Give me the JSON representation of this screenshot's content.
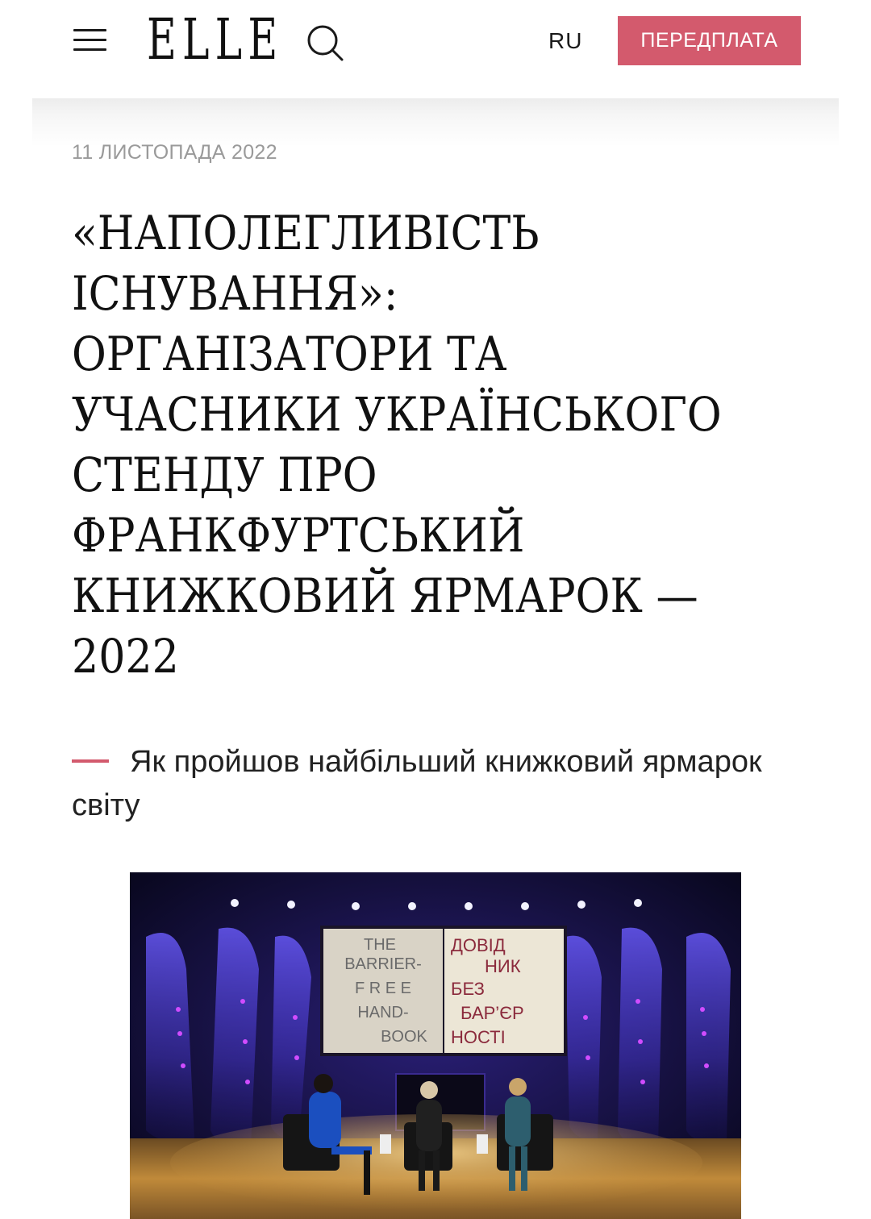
{
  "header": {
    "logo": "ELLE",
    "lang_label": "RU",
    "subscribe_label": "ПЕРЕДПЛАТА",
    "accent_color": "#d35a6d"
  },
  "article": {
    "date": "11 ЛИСТОПАДА 2022",
    "title_lines": [
      "«НАПОЛЕГЛИВІСТЬ",
      "ІСНУВАННЯ»:",
      "ОРГАНІЗАТОРИ ТА",
      "УЧАСНИКИ УКРАЇНСЬКОГО",
      "СТЕНДУ ПРО",
      "ФРАНКФУРТСЬКИЙ",
      "КНИЖКОВИЙ ЯРМАРОК —",
      "2022"
    ],
    "lead": "Як пройшов найбільший книжковий ярмарок світу"
  },
  "photo": {
    "screen_left_lines": [
      "THE",
      "BARRIER-",
      "F R E E",
      "HAND-",
      "BOOK"
    ],
    "screen_right_lines": [
      "ДОВІД",
      "НИК",
      "БЕЗ",
      "БАР’ЄР",
      "НОСТІ"
    ]
  },
  "icons": {
    "menu": "hamburger-icon",
    "search": "search-icon"
  }
}
